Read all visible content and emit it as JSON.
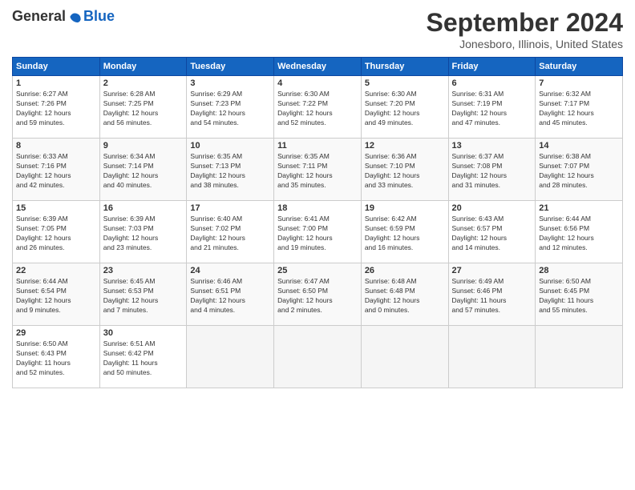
{
  "header": {
    "logo": "GeneralBlue",
    "title": "September 2024",
    "location": "Jonesboro, Illinois, United States"
  },
  "calendar": {
    "days_of_week": [
      "Sunday",
      "Monday",
      "Tuesday",
      "Wednesday",
      "Thursday",
      "Friday",
      "Saturday"
    ],
    "weeks": [
      [
        {
          "day": "",
          "info": ""
        },
        {
          "day": "2",
          "info": "Sunrise: 6:28 AM\nSunset: 7:25 PM\nDaylight: 12 hours\nand 56 minutes."
        },
        {
          "day": "3",
          "info": "Sunrise: 6:29 AM\nSunset: 7:23 PM\nDaylight: 12 hours\nand 54 minutes."
        },
        {
          "day": "4",
          "info": "Sunrise: 6:30 AM\nSunset: 7:22 PM\nDaylight: 12 hours\nand 52 minutes."
        },
        {
          "day": "5",
          "info": "Sunrise: 6:30 AM\nSunset: 7:20 PM\nDaylight: 12 hours\nand 49 minutes."
        },
        {
          "day": "6",
          "info": "Sunrise: 6:31 AM\nSunset: 7:19 PM\nDaylight: 12 hours\nand 47 minutes."
        },
        {
          "day": "7",
          "info": "Sunrise: 6:32 AM\nSunset: 7:17 PM\nDaylight: 12 hours\nand 45 minutes."
        }
      ],
      [
        {
          "day": "1",
          "info": "Sunrise: 6:27 AM\nSunset: 7:26 PM\nDaylight: 12 hours\nand 59 minutes."
        },
        {
          "day": "",
          "info": ""
        },
        {
          "day": "",
          "info": ""
        },
        {
          "day": "",
          "info": ""
        },
        {
          "day": "",
          "info": ""
        },
        {
          "day": "",
          "info": ""
        },
        {
          "day": "",
          "info": ""
        }
      ],
      [
        {
          "day": "8",
          "info": "Sunrise: 6:33 AM\nSunset: 7:16 PM\nDaylight: 12 hours\nand 42 minutes."
        },
        {
          "day": "9",
          "info": "Sunrise: 6:34 AM\nSunset: 7:14 PM\nDaylight: 12 hours\nand 40 minutes."
        },
        {
          "day": "10",
          "info": "Sunrise: 6:35 AM\nSunset: 7:13 PM\nDaylight: 12 hours\nand 38 minutes."
        },
        {
          "day": "11",
          "info": "Sunrise: 6:35 AM\nSunset: 7:11 PM\nDaylight: 12 hours\nand 35 minutes."
        },
        {
          "day": "12",
          "info": "Sunrise: 6:36 AM\nSunset: 7:10 PM\nDaylight: 12 hours\nand 33 minutes."
        },
        {
          "day": "13",
          "info": "Sunrise: 6:37 AM\nSunset: 7:08 PM\nDaylight: 12 hours\nand 31 minutes."
        },
        {
          "day": "14",
          "info": "Sunrise: 6:38 AM\nSunset: 7:07 PM\nDaylight: 12 hours\nand 28 minutes."
        }
      ],
      [
        {
          "day": "15",
          "info": "Sunrise: 6:39 AM\nSunset: 7:05 PM\nDaylight: 12 hours\nand 26 minutes."
        },
        {
          "day": "16",
          "info": "Sunrise: 6:39 AM\nSunset: 7:03 PM\nDaylight: 12 hours\nand 23 minutes."
        },
        {
          "day": "17",
          "info": "Sunrise: 6:40 AM\nSunset: 7:02 PM\nDaylight: 12 hours\nand 21 minutes."
        },
        {
          "day": "18",
          "info": "Sunrise: 6:41 AM\nSunset: 7:00 PM\nDaylight: 12 hours\nand 19 minutes."
        },
        {
          "day": "19",
          "info": "Sunrise: 6:42 AM\nSunset: 6:59 PM\nDaylight: 12 hours\nand 16 minutes."
        },
        {
          "day": "20",
          "info": "Sunrise: 6:43 AM\nSunset: 6:57 PM\nDaylight: 12 hours\nand 14 minutes."
        },
        {
          "day": "21",
          "info": "Sunrise: 6:44 AM\nSunset: 6:56 PM\nDaylight: 12 hours\nand 12 minutes."
        }
      ],
      [
        {
          "day": "22",
          "info": "Sunrise: 6:44 AM\nSunset: 6:54 PM\nDaylight: 12 hours\nand 9 minutes."
        },
        {
          "day": "23",
          "info": "Sunrise: 6:45 AM\nSunset: 6:53 PM\nDaylight: 12 hours\nand 7 minutes."
        },
        {
          "day": "24",
          "info": "Sunrise: 6:46 AM\nSunset: 6:51 PM\nDaylight: 12 hours\nand 4 minutes."
        },
        {
          "day": "25",
          "info": "Sunrise: 6:47 AM\nSunset: 6:50 PM\nDaylight: 12 hours\nand 2 minutes."
        },
        {
          "day": "26",
          "info": "Sunrise: 6:48 AM\nSunset: 6:48 PM\nDaylight: 12 hours\nand 0 minutes."
        },
        {
          "day": "27",
          "info": "Sunrise: 6:49 AM\nSunset: 6:46 PM\nDaylight: 11 hours\nand 57 minutes."
        },
        {
          "day": "28",
          "info": "Sunrise: 6:50 AM\nSunset: 6:45 PM\nDaylight: 11 hours\nand 55 minutes."
        }
      ],
      [
        {
          "day": "29",
          "info": "Sunrise: 6:50 AM\nSunset: 6:43 PM\nDaylight: 11 hours\nand 52 minutes."
        },
        {
          "day": "30",
          "info": "Sunrise: 6:51 AM\nSunset: 6:42 PM\nDaylight: 11 hours\nand 50 minutes."
        },
        {
          "day": "",
          "info": ""
        },
        {
          "day": "",
          "info": ""
        },
        {
          "day": "",
          "info": ""
        },
        {
          "day": "",
          "info": ""
        },
        {
          "day": "",
          "info": ""
        }
      ]
    ]
  }
}
